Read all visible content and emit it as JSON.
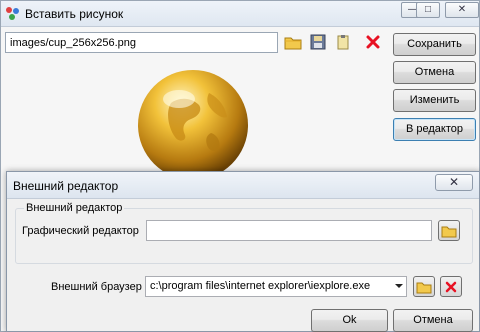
{
  "main_window": {
    "title": "Вставить рисунок",
    "titlebar_buttons": {
      "minimize": "—",
      "maximize": "□",
      "close": "✕"
    },
    "file_path": "images/cup_256x256.png",
    "toolbar_icons": [
      "open-folder-icon",
      "save-disk-icon",
      "clipboard-icon",
      "delete-red-x-icon"
    ],
    "buttons": {
      "save": "Сохранить",
      "cancel": "Отмена",
      "modify": "Изменить",
      "in_editor": "В редактор"
    }
  },
  "editor_dialog": {
    "title": "Внешний редактор",
    "close": "✕",
    "group_title": "Внешний редактор",
    "graphic_editor_label": "Графический редактор",
    "graphic_editor_value": "",
    "browser_label": "Внешний браузер",
    "browser_value": "c:\\program files\\internet explorer\\iexplore.exe",
    "ok": "Ok",
    "cancel": "Отмена"
  },
  "colors": {
    "accent": "#3c7fb1",
    "delete": "#e81123",
    "folder": "#f2c94c",
    "gold": "#d89b1c"
  }
}
